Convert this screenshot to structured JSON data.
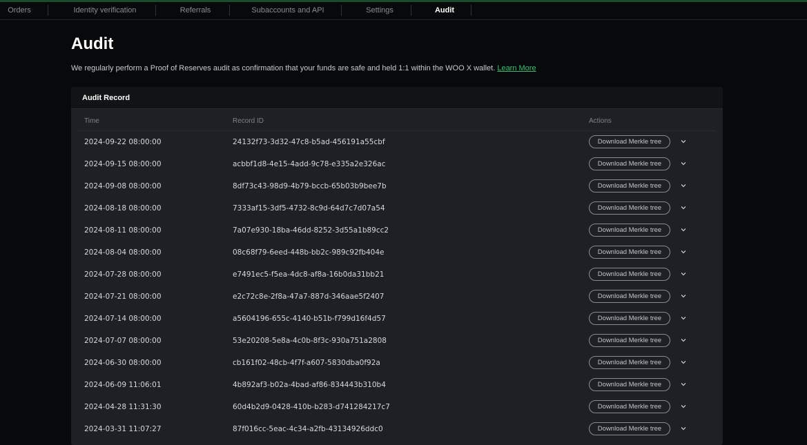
{
  "tabs": [
    {
      "label": "Orders",
      "active": false
    },
    {
      "label": "Identity verification",
      "active": false
    },
    {
      "label": "Referrals",
      "active": false
    },
    {
      "label": "Subaccounts and API",
      "active": false
    },
    {
      "label": "Settings",
      "active": false
    },
    {
      "label": "Audit",
      "active": true
    }
  ],
  "page": {
    "title": "Audit",
    "description": "We regularly perform a Proof of Reserves audit as confirmation that your funds are safe and held 1:1 within the WOO X wallet.",
    "learn_more": "Learn More"
  },
  "panel": {
    "title": "Audit Record",
    "columns": {
      "time": "Time",
      "record_id": "Record ID",
      "actions": "Actions"
    },
    "download_label": "Download Merkle tree",
    "rows": [
      {
        "time": "2024-09-22 08:00:00",
        "id": "24132f73-3d32-47c8-b5ad-456191a55cbf"
      },
      {
        "time": "2024-09-15 08:00:00",
        "id": "acbbf1d8-4e15-4add-9c78-e335a2e326ac"
      },
      {
        "time": "2024-09-08 08:00:00",
        "id": "8df73c43-98d9-4b79-bccb-65b03b9bee7b"
      },
      {
        "time": "2024-08-18 08:00:00",
        "id": "7333af15-3df5-4732-8c9d-64d7c7d07a54"
      },
      {
        "time": "2024-08-11 08:00:00",
        "id": "7a07e930-18ba-46dd-8252-3d55a1b89cc2"
      },
      {
        "time": "2024-08-04 08:00:00",
        "id": "08c68f79-6eed-448b-bb2c-989c92fb404e"
      },
      {
        "time": "2024-07-28 08:00:00",
        "id": "e7491ec5-f5ea-4dc8-af8a-16b0da31bb21"
      },
      {
        "time": "2024-07-21 08:00:00",
        "id": "e2c72c8e-2f8a-47a7-887d-346aae5f2407"
      },
      {
        "time": "2024-07-14 08:00:00",
        "id": "a5604196-655c-4140-b51b-f799d16f4d57"
      },
      {
        "time": "2024-07-07 08:00:00",
        "id": "53e20208-5e8a-4c0b-8f3c-930a751a2808"
      },
      {
        "time": "2024-06-30 08:00:00",
        "id": "cb161f02-48cb-4f7f-a607-5830dba0f92a"
      },
      {
        "time": "2024-06-09 11:06:01",
        "id": "4b892af3-b02a-4bad-af86-834443b310b4"
      },
      {
        "time": "2024-04-28 11:31:30",
        "id": "60d4b2d9-0428-410b-b283-d741284217c7"
      },
      {
        "time": "2024-03-31 11:07:27",
        "id": "87f016cc-5eac-4c34-a2fb-43134926ddc0"
      }
    ]
  },
  "colors": {
    "accent": "#2fc17a",
    "background": "#08090a",
    "panel": "#1d2024"
  },
  "icons": {
    "expand": "chevron-down-icon"
  }
}
